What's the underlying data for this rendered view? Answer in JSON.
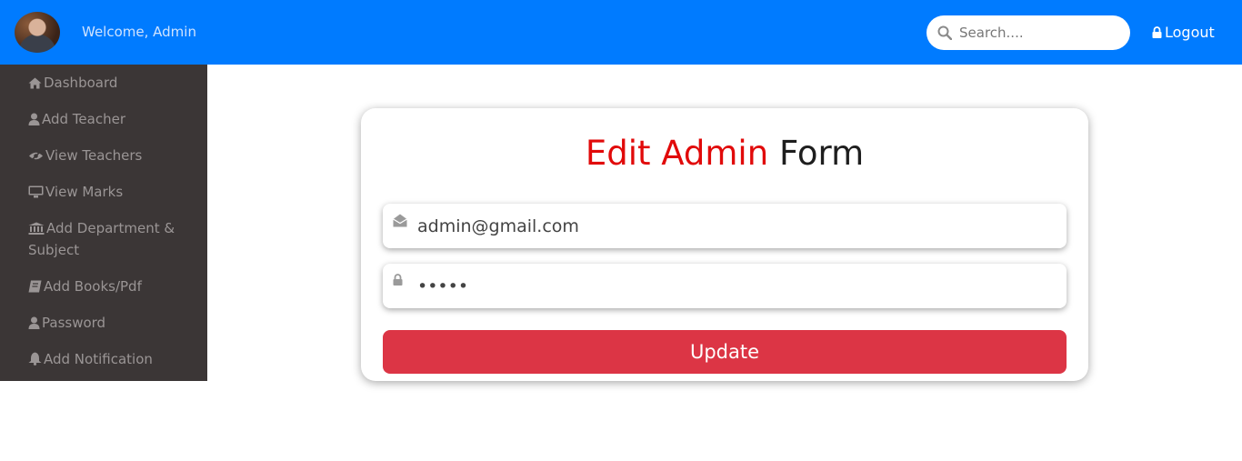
{
  "header": {
    "welcome_text": "Welcome, Admin",
    "search_placeholder": "Search....",
    "logout_label": "Logout"
  },
  "sidebar": {
    "items": [
      {
        "label": "Dashboard",
        "icon": "home-icon"
      },
      {
        "label": "Add Teacher",
        "icon": "user-icon"
      },
      {
        "label": "View Teachers",
        "icon": "eye-slash-icon"
      },
      {
        "label": "View Marks",
        "icon": "desktop-icon"
      },
      {
        "label": "Add Department & Subject",
        "icon": "bank-icon"
      },
      {
        "label": "Add Books/Pdf",
        "icon": "book-icon"
      },
      {
        "label": "Password",
        "icon": "user-icon"
      },
      {
        "label": "Add Notification",
        "icon": "bell-icon"
      }
    ]
  },
  "form": {
    "title_highlight": "Edit Admin",
    "title_rest": "Form",
    "email_value": "admin@gmail.com",
    "password_value": "•••••",
    "update_label": "Update"
  },
  "colors": {
    "header_bg": "#007bff",
    "sidebar_bg": "#3b3636",
    "title_red": "#e10a0a",
    "button_red": "#dc3545"
  }
}
